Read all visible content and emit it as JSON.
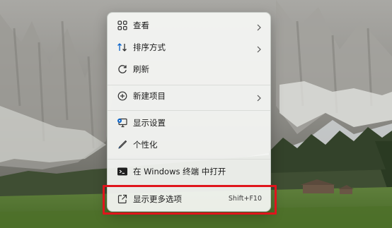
{
  "context_menu": {
    "items": [
      {
        "label": "查看",
        "icon": "grid-icon",
        "has_submenu": true
      },
      {
        "label": "排序方式",
        "icon": "sort-arrows-icon",
        "has_submenu": true
      },
      {
        "label": "刷新",
        "icon": "refresh-icon",
        "has_submenu": false
      },
      {
        "label": "新建项目",
        "icon": "plus-circle-icon",
        "has_submenu": true
      },
      {
        "label": "显示设置",
        "icon": "display-settings-icon",
        "has_submenu": false
      },
      {
        "label": "个性化",
        "icon": "pen-icon",
        "has_submenu": false
      },
      {
        "label": "在 Windows 终端 中打开",
        "icon": "terminal-icon",
        "has_submenu": false
      },
      {
        "label": "显示更多选项",
        "icon": "open-external-icon",
        "shortcut": "Shift+F10",
        "has_submenu": false
      }
    ]
  },
  "colors": {
    "highlight_border": "#e0141c",
    "menu_background": "#f6f7f5",
    "accent_icon": "#0a63c9"
  }
}
